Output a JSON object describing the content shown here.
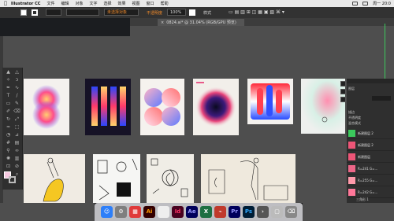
{
  "menubar": {
    "apple": "",
    "app": "Illustrator CC",
    "items": [
      "文件",
      "编辑",
      "对象",
      "文字",
      "选择",
      "效果",
      "视图",
      "窗口",
      "帮助"
    ],
    "clock": "周一  20:0"
  },
  "control_bar": {
    "no_selection": "未选择对象",
    "stroke_label": "描边",
    "stroke_value": "1",
    "style_label": "不透明度",
    "opacity_value": "100%",
    "style_name": "样式"
  },
  "tab": {
    "title": "0824.ai* @ 31.04% (RGB/GPU 预览)"
  },
  "panel": {
    "layers_title": "图层",
    "rows": [
      "描边",
      "不透明度",
      "混合模式"
    ],
    "layer_names": [
      "新建图层 2",
      "新建图层 2",
      "新建图层",
      "R=241 G=...",
      "R=255 G=...",
      "R=242 G=..."
    ],
    "bottom_label": "三角形 1"
  },
  "dock": {
    "apps": [
      "Ai",
      "Id",
      "Ae",
      "X",
      "Pr",
      "Ps"
    ]
  },
  "colors": {
    "accent": "#3bc95c",
    "fill": "#f6c9e0",
    "canvas": "#4e4e4e"
  }
}
